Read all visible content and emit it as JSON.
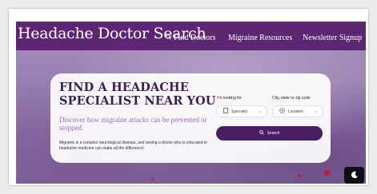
{
  "header": {
    "logo_text": "Headache Doctor Search",
    "nav": [
      {
        "label": "Find Doctors",
        "icon": "search-icon"
      },
      {
        "label": "Migraine Resources"
      },
      {
        "label": "Newsletter Signup"
      }
    ]
  },
  "hero": {
    "headline": "FIND A HEADACHE SPECIALIST NEAR YOU",
    "subheadline": "Discover how migraine attacks can be prevented or stopped.",
    "blurb": "Migraine is a complex neurological disease, and seeing a doctor who is educated in headache medicine can make all the difference!",
    "looking_for_label": "I'm looking for",
    "specialty_value": "Specialty",
    "location_label": "City, state or zip code",
    "location_value": "Location",
    "search_button": "Search"
  },
  "colors": {
    "header_bg": "#5c2672",
    "headline": "#3d1f52",
    "subheadline": "#9b6bb5",
    "search_button": "#4b1d63"
  },
  "dark_mode_toggle_icon": "moon-icon"
}
